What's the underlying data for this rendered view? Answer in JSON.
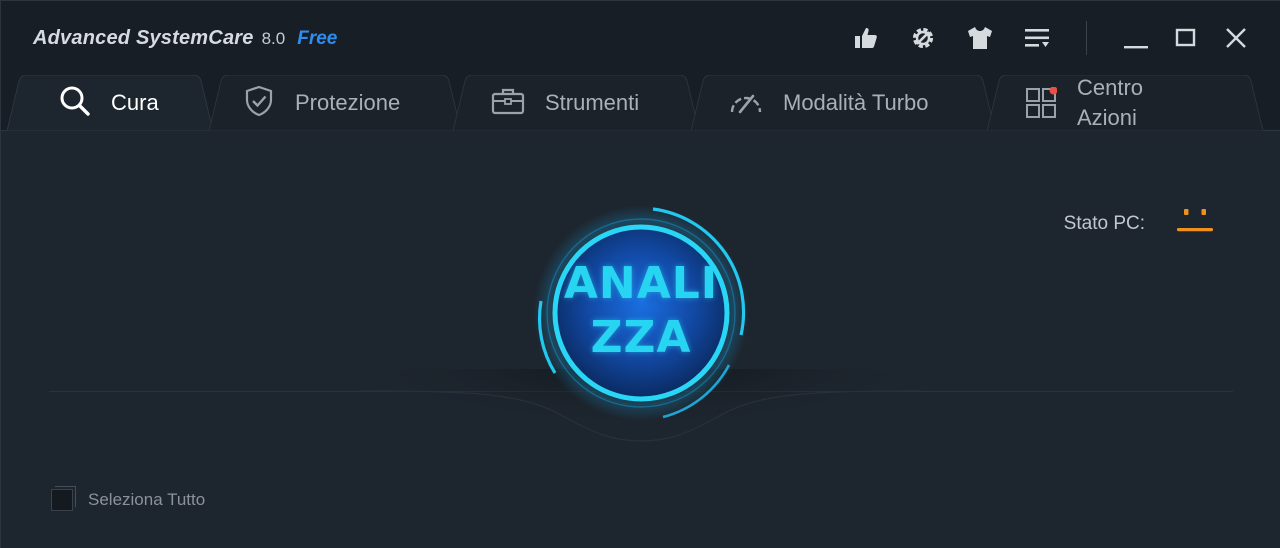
{
  "title_bar": {
    "app_name": "Advanced SystemCare",
    "version": "8.0",
    "edition": "Free",
    "icons": [
      "thumbs-up-icon",
      "settings-gear-icon",
      "skin-shirt-icon",
      "menu-list-icon"
    ],
    "window_controls": [
      "minimize-icon",
      "maximize-icon",
      "close-icon"
    ]
  },
  "tabs": [
    {
      "label": "Cura",
      "icon": "search-icon",
      "active": true
    },
    {
      "label": "Protezione",
      "icon": "shield-check-icon",
      "active": false
    },
    {
      "label": "Strumenti",
      "icon": "toolbox-icon",
      "active": false
    },
    {
      "label": "Modalità Turbo",
      "icon": "speedometer-icon",
      "active": false
    },
    {
      "label": "Centro Azioni",
      "label_line1": "Centro",
      "label_line2": "Azioni",
      "icon": "grid-apps-icon",
      "active": false,
      "notification_dot": true
    }
  ],
  "main": {
    "status_label": "Stato PC:",
    "status_icon": "neutral-face-icon",
    "scan_button": {
      "line1": "ANALI",
      "line2": "ZZA"
    },
    "select_all_label": "Seleziona Tutto",
    "select_all_checked": false
  },
  "colors": {
    "accent_blue": "#2f8df0",
    "scan_cyan": "#27d5f2",
    "status_orange": "#f0901e",
    "notification_red": "#e8504a"
  }
}
